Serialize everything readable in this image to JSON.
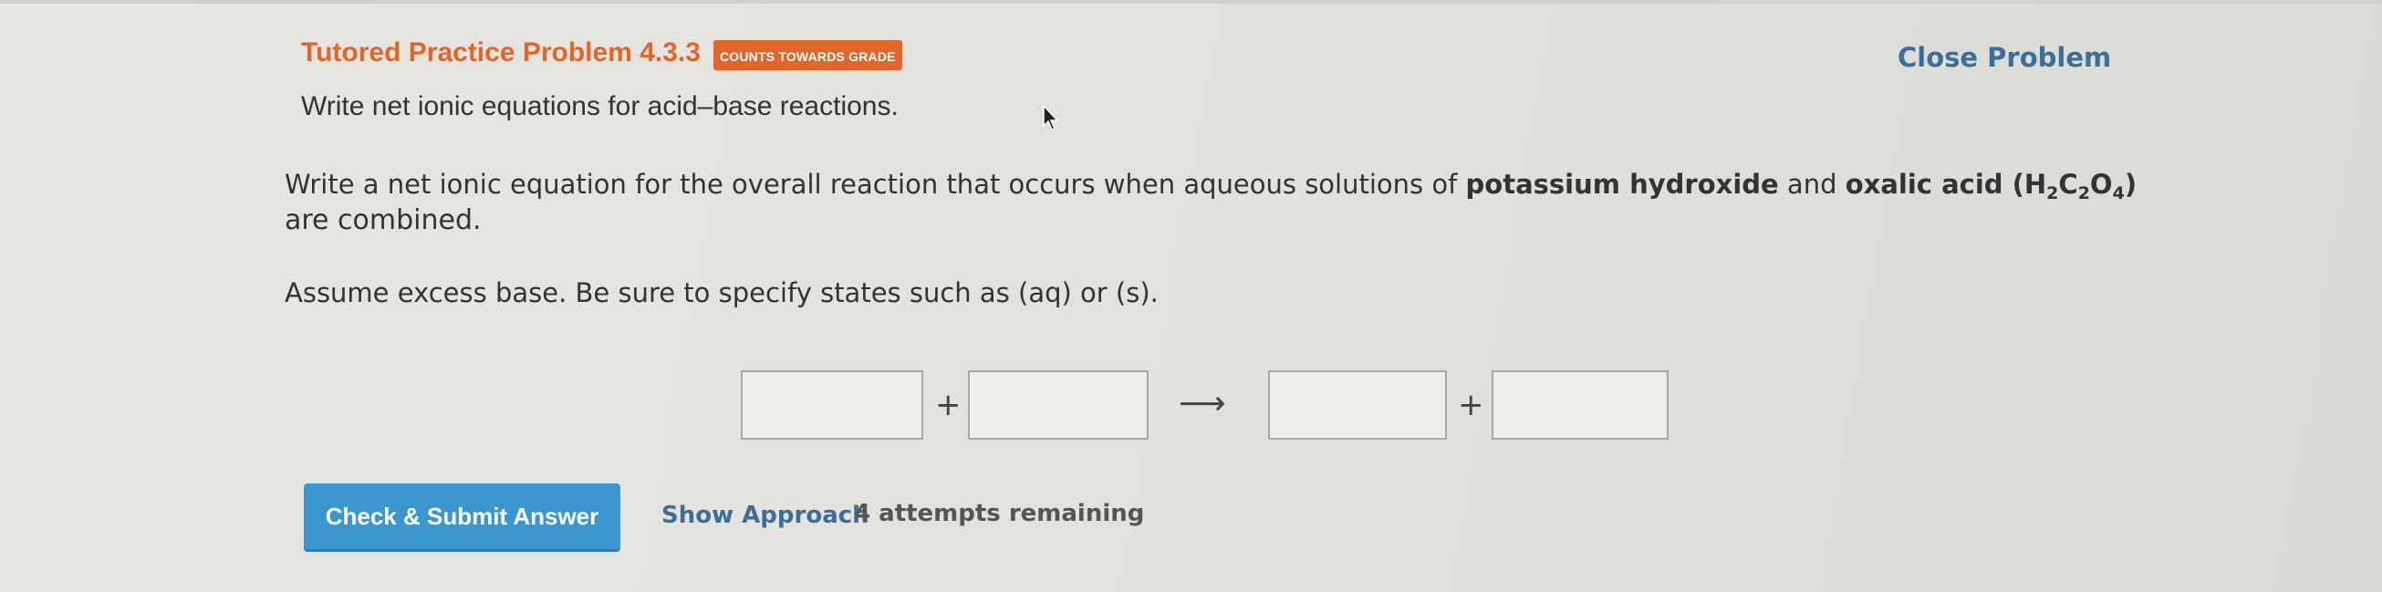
{
  "header": {
    "title": "Tutored Practice Problem 4.3.3",
    "badge": "COUNTS TOWARDS GRADE",
    "close_label": "Close Problem"
  },
  "subtitle": "Write net ionic equations for acid–base reactions.",
  "question": {
    "intro": "Write a net ionic equation for the overall reaction that occurs when aqueous solutions of ",
    "reactant1": "potassium hydroxide",
    "conjunction": " and ",
    "reactant2": "oxalic acid",
    "formula_open": " (H",
    "sub1": "2",
    "formula_c": "C",
    "sub2": "2",
    "formula_o": "O",
    "sub3": "4",
    "formula_close": ")",
    "line2": "are combined."
  },
  "instruction": "Assume excess base. Be sure to specify states such as (aq) or (s).",
  "equation": {
    "plus_symbol": "+",
    "arrow_symbol": "⟶",
    "fields": [
      "",
      "",
      "",
      ""
    ]
  },
  "actions": {
    "submit_label": "Check & Submit Answer",
    "approach_label": "Show Approach",
    "attempts_text": "4 attempts remaining"
  },
  "colors": {
    "accent_orange": "#e0662b",
    "link_blue": "#3b6e99",
    "button_blue": "#3d97cf"
  }
}
